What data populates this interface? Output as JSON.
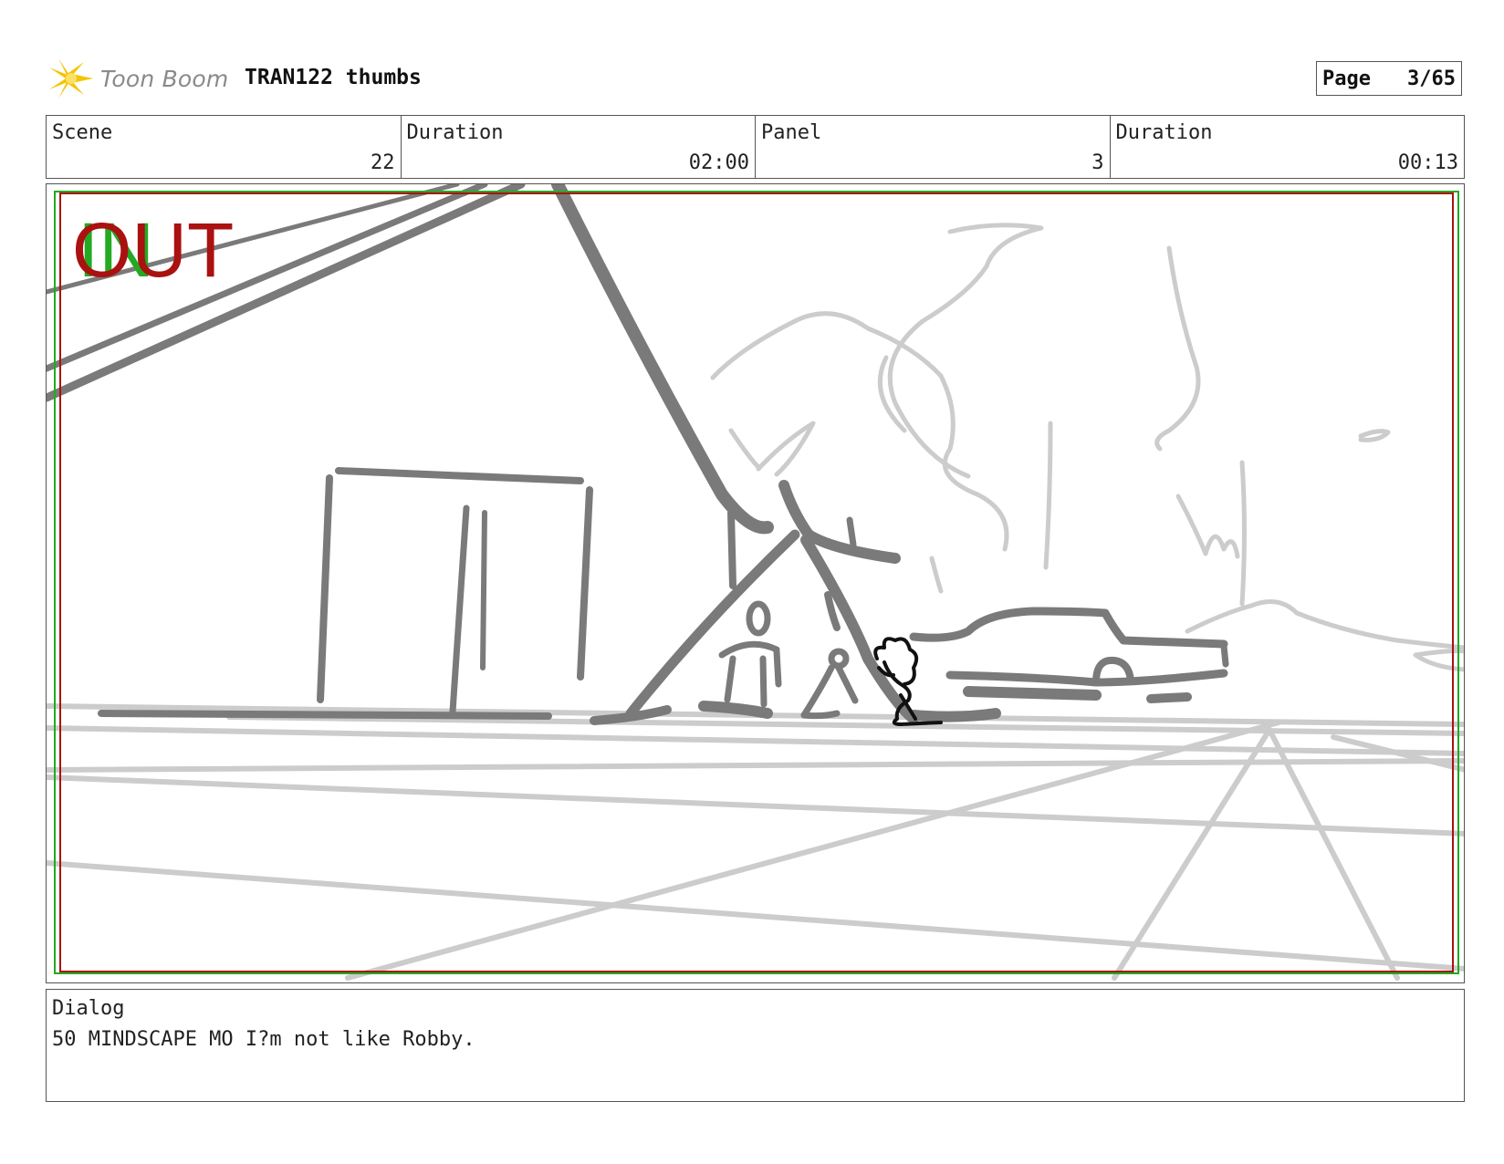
{
  "header": {
    "brand": "Toon Boom",
    "title": "TRAN122 thumbs",
    "page_label": "Page",
    "page_value": "3/65"
  },
  "info": [
    {
      "label": "Scene",
      "value": "22"
    },
    {
      "label": "Duration",
      "value": "02:00"
    },
    {
      "label": "Panel",
      "value": "3"
    },
    {
      "label": "Duration",
      "value": "00:13"
    }
  ],
  "panel": {
    "transition_in": "IN",
    "transition_out": "OUT",
    "safe_frame_color": "#aa1111",
    "field_guide_color": "#22aa22"
  },
  "dialog": {
    "label": "Dialog",
    "text": "50 MINDSCAPE MO I?m not like Robby."
  },
  "colors": {
    "sketch_dark": "#7a7a7a",
    "sketch_light": "#c8c8c8",
    "logo_accent": "#f5c400"
  }
}
